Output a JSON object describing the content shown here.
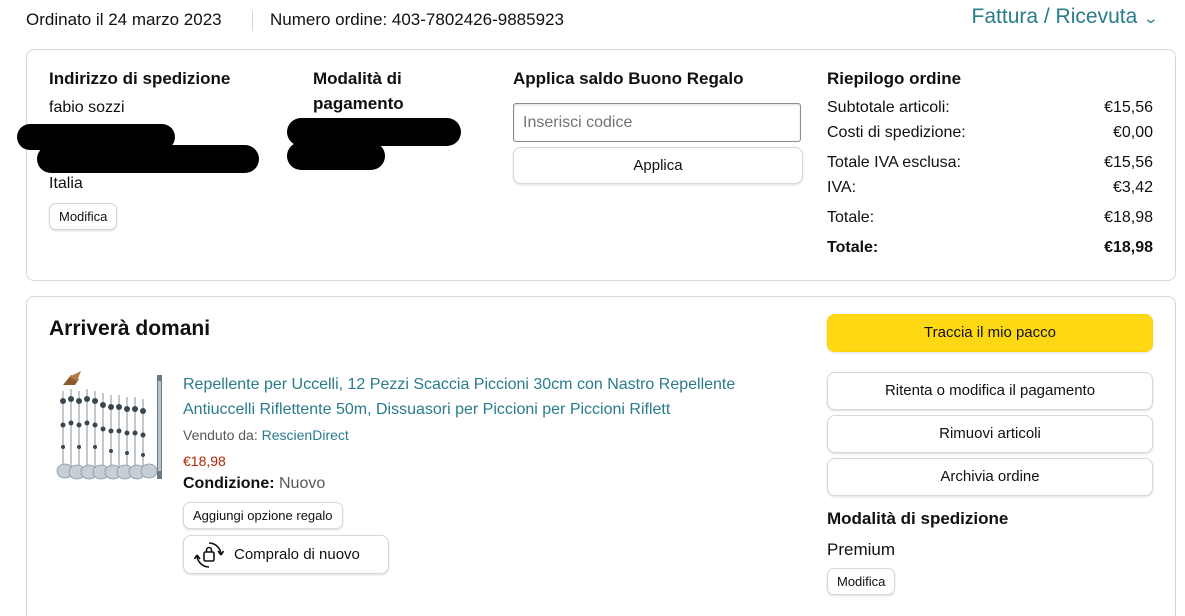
{
  "header": {
    "order_date": "Ordinato il 24 marzo 2023",
    "order_number": "Numero ordine: 403-7802426-9885923",
    "invoice_link": "Fattura / Ricevuta"
  },
  "shipping_address": {
    "title": "Indirizzo di spedizione",
    "name": "fabio sozzi",
    "country": "Italia",
    "edit_label": "Modifica"
  },
  "payment": {
    "title": "Modalità di pagamento"
  },
  "gift_card": {
    "title": "Applica saldo Buono Regalo",
    "placeholder": "Inserisci codice",
    "apply_label": "Applica"
  },
  "order_summary": {
    "title": "Riepilogo ordine",
    "rows": [
      {
        "label": "Subtotale articoli:",
        "value": "€15,56"
      },
      {
        "label": "Costi di spedizione:",
        "value": "€0,00"
      },
      {
        "label": "Totale IVA esclusa:",
        "value": "€15,56"
      },
      {
        "label": "IVA:",
        "value": "€3,42"
      },
      {
        "label": "Totale:",
        "value": "€18,98"
      },
      {
        "label": "Totale:",
        "value": "€18,98"
      }
    ]
  },
  "delivery": {
    "title": "Arriverà domani",
    "product": {
      "title": "Repellente per Uccelli, 12 Pezzi Scaccia Piccioni 30cm con Nastro Repellente Antiuccelli Riflettente 50m, Dissuasori per Piccioni per Piccioni Riflett",
      "sold_by_label": "Venduto da:",
      "seller": "RescienDirect",
      "price": "€18,98",
      "condition_label": "Condizione:",
      "condition_value": "Nuovo",
      "gift_option_label": "Aggiungi opzione regalo",
      "buy_again_label": "Compralo di nuovo"
    },
    "actions": {
      "track": "Traccia il mio pacco",
      "retry_payment": "Ritenta o modifica il pagamento",
      "remove_items": "Rimuovi articoli",
      "archive": "Archivia ordine"
    },
    "shipping_method": {
      "title": "Modalità di spedizione",
      "value": "Premium",
      "edit_label": "Modifica"
    }
  },
  "colors": {
    "link": "#2a7b8b",
    "price": "#b12704",
    "primary_button": "#ffd814",
    "border": "#d5d9d9"
  }
}
